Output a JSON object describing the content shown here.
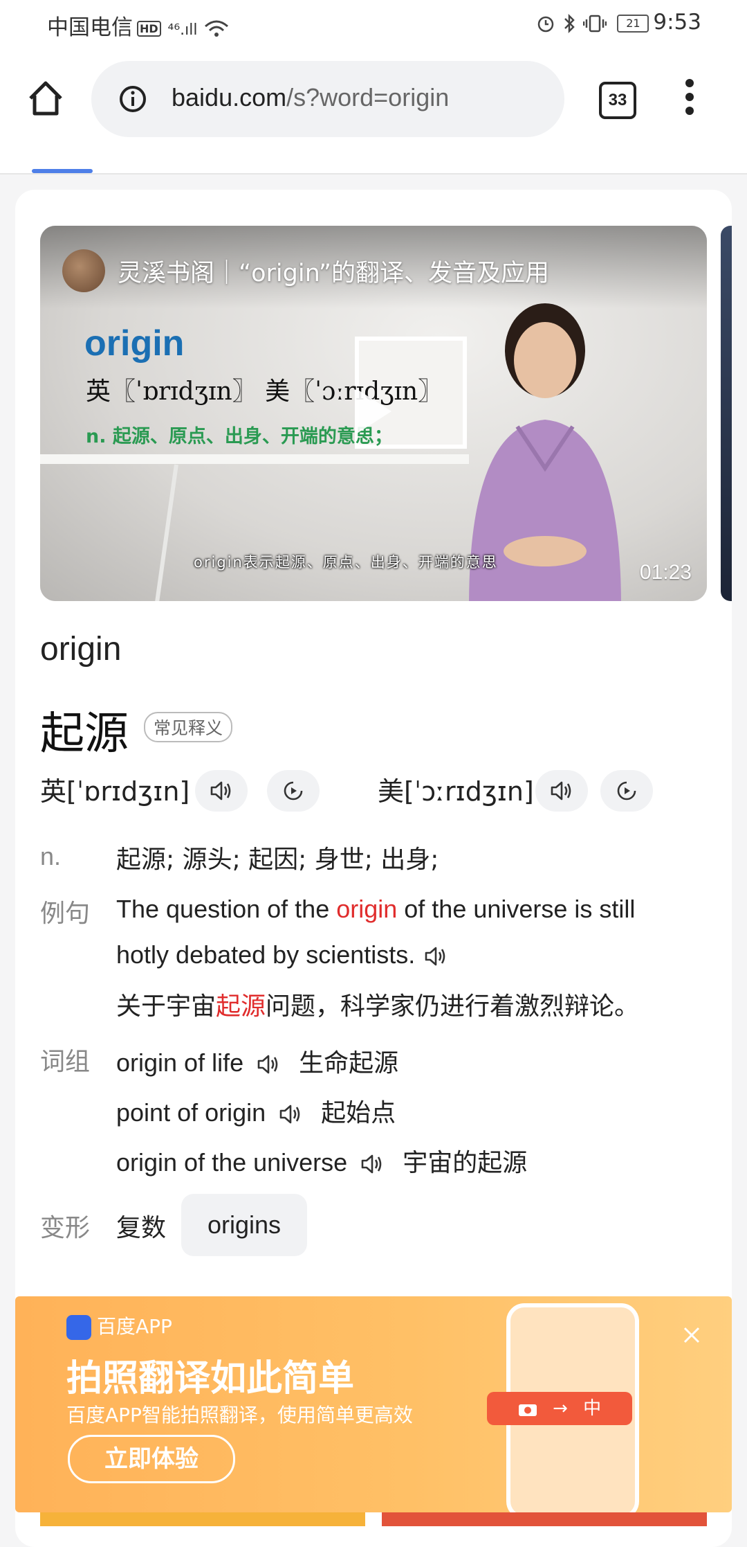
{
  "status": {
    "carrier": "中国电信",
    "hd": "HD",
    "signal": "⁴⁶.ıll",
    "battery": "21",
    "time": "9:53"
  },
  "toolbar": {
    "url_host": "baidu.com",
    "url_path": "/s?word=origin",
    "tab_count": "33"
  },
  "video": {
    "channel_title": "灵溪书阁｜“origin”的翻译、发音及应用",
    "word": "origin",
    "phonetic": "英〖ˈɒrɪdʒɪn〗 美〖ˈɔːrɪdʒɪn〗",
    "meaning": "n.  起源、原点、出身、开端的意思；",
    "subtitle": "origin表示起源、原点、出身、开端的意思",
    "duration": "01:23"
  },
  "entry": {
    "headword": "origin",
    "translation": "起源",
    "tag": "常见释义",
    "uk_pron": "英[ˈɒrɪdʒɪn]",
    "us_pron": "美[ˈɔːrɪdʒɪn]",
    "pos": "n.",
    "definition": "起源; 源头; 起因; 身世; 出身;",
    "example_label": "例句",
    "example_pre": "The question of the ",
    "example_hl": "origin",
    "example_post": " of the universe is still",
    "example_line2": "hotly debated by scientists.",
    "example_zh_pre": "关于宇宙",
    "example_zh_hl": "起源",
    "example_zh_post": "问题，科学家仍进行着激烈辩论。",
    "phrase_label": "词组",
    "phrases": [
      {
        "en": "origin of life",
        "zh": "生命起源"
      },
      {
        "en": "point of origin",
        "zh": "起始点"
      },
      {
        "en": "origin of the universe",
        "zh": "宇宙的起源"
      }
    ],
    "forms_label": "变形",
    "plural_label": "复数",
    "plural": "origins"
  },
  "banner": {
    "app_name": "百度APP",
    "headline": "拍照翻译如此简单",
    "subline": "百度APP智能拍照翻译，使用简单更高效",
    "cta": "立即体验",
    "phone_bar": "中"
  },
  "colors": {
    "accent_blue": "#4e7fe8",
    "highlight_red": "#e02c2c",
    "banner_orange": "#ffb258"
  }
}
